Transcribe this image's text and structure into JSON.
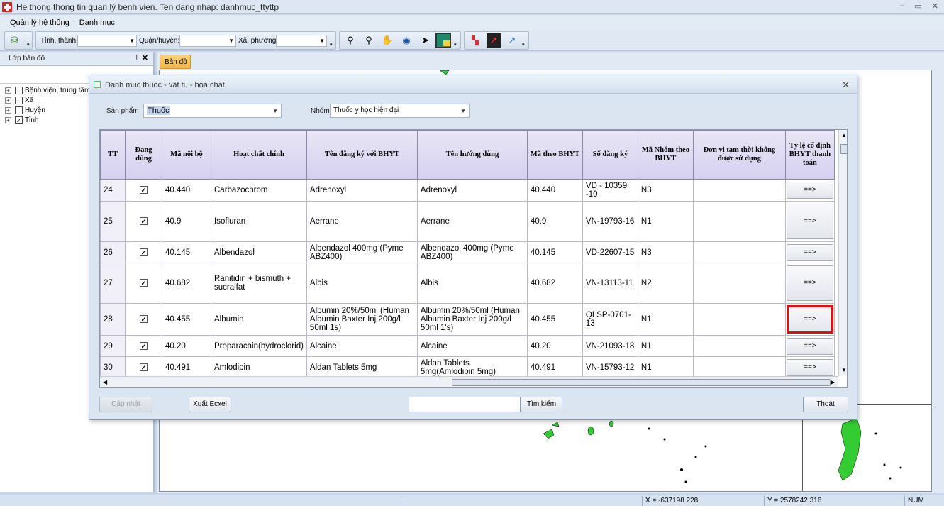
{
  "window": {
    "title": "He thong thong tin quan lý benh vien. Ten dang nhap: danhmuc_ttyttp",
    "controls": [
      "–",
      "▭",
      "✕"
    ]
  },
  "menu": [
    "Quản lý hệ thống",
    "Danh mục"
  ],
  "toolbar": {
    "province_label": "Tỉnh, thành:",
    "district_label": "Quận/huyện:",
    "ward_label": "Xã, phường:"
  },
  "left_panel": {
    "title": "Lớp bản đồ",
    "pin": "⊣",
    "close": "✕",
    "layers": [
      {
        "label": "Bệnh viện, trung tâm",
        "checked": false
      },
      {
        "label": "Xã",
        "checked": false
      },
      {
        "label": "Huyện",
        "checked": false
      },
      {
        "label": "Tỉnh",
        "checked": true
      }
    ]
  },
  "map": {
    "tab_label": "Bản đồ"
  },
  "status": {
    "x": "X = -637198.228",
    "y": "Y = 2578242.316",
    "num": "NUM"
  },
  "dialog": {
    "title": "Danh muc thuoc - vât tu - hóa chat",
    "close": "✕",
    "product_label": "Sản phẩm",
    "product_value": "Thuốc",
    "group_label": "Nhóm",
    "group_value": "Thuốc y học hiện đại",
    "buttons": {
      "update": "Cập nhật",
      "export": "Xuất Ecxel",
      "search": "Tìm kiếm",
      "exit": "Thoát"
    },
    "search_value": "",
    "table": {
      "headers": [
        "TT",
        "Đang dùng",
        "Mã nội bộ",
        "Hoạt chất chính",
        "Tên đăng ký với BHYT",
        "Tên hướng dùng",
        "Mã theo BHYT",
        "Số đăng ký",
        "Mã Nhóm theo BHYT",
        "Đơn vị tạm thời không được sử dụng",
        "Tỷ lệ cố định BHYT thanh toán"
      ],
      "rows": [
        {
          "tt": "24",
          "checked": true,
          "ma": "40.440",
          "hoat_chat": "Carbazochrom",
          "ten_dk": "Adrenoxyl",
          "ten_hd": "Adrenoxyl",
          "ma_bhyt": "40.440",
          "so_dk": "VD - 10359 -10",
          "nhom": "N3",
          "don_vi": "",
          "btn": "==>"
        },
        {
          "tt": "25",
          "checked": true,
          "ma": "40.9",
          "hoat_chat": "Isofluran",
          "ten_dk": "Aerrane",
          "ten_hd": "Aerrane",
          "ma_bhyt": "40.9",
          "so_dk": "VN-19793-16",
          "nhom": "N1",
          "don_vi": "",
          "btn": "==>"
        },
        {
          "tt": "26",
          "checked": true,
          "ma": "40.145",
          "hoat_chat": "Albendazol",
          "ten_dk": "Albendazol 400mg (Pyme ABZ400)",
          "ten_hd": "Albendazol 400mg (Pyme ABZ400)",
          "ma_bhyt": "40.145",
          "so_dk": "VD-22607-15",
          "nhom": "N3",
          "don_vi": "",
          "btn": "==>"
        },
        {
          "tt": "27",
          "checked": true,
          "ma": "40.682",
          "hoat_chat": "Ranitidin + bismuth + sucralfat",
          "ten_dk": "Albis",
          "ten_hd": "Albis",
          "ma_bhyt": "40.682",
          "so_dk": "VN-13113-11",
          "nhom": "N2",
          "don_vi": "",
          "btn": "==>"
        },
        {
          "tt": "28",
          "checked": true,
          "ma": "40.455",
          "hoat_chat": "Albumin",
          "ten_dk": "Albumin 20%/50ml (Human Albumin Baxter Inj 200g/l 50ml 1s)",
          "ten_hd": "Albumin 20%/50ml (Human Albumin Baxter Inj 200g/l 50ml 1's)",
          "ma_bhyt": "40.455",
          "so_dk": "QLSP-0701-13",
          "nhom": "N1",
          "don_vi": "",
          "btn": "==>"
        },
        {
          "tt": "29",
          "checked": true,
          "ma": "40.20",
          "hoat_chat": "Proparacain(hydroclorid)",
          "ten_dk": "Alcaine",
          "ten_hd": "Alcaine",
          "ma_bhyt": "40.20",
          "so_dk": "VN-21093-18",
          "nhom": "N1",
          "don_vi": "",
          "btn": "==>"
        },
        {
          "tt": "30",
          "checked": true,
          "ma": "40.491",
          "hoat_chat": "Amlodipin",
          "ten_dk": "Aldan Tablets 5mg",
          "ten_hd": "Aldan Tablets 5mg(Amlodipin 5mg)",
          "ma_bhyt": "40.491",
          "so_dk": "VN-15793-12",
          "nhom": "N1",
          "don_vi": "",
          "btn": "==>"
        }
      ]
    }
  },
  "colors": {
    "highlight_border": "#e01010",
    "header_bg": "#d5d0ef",
    "map_tab": "#f3b54a",
    "map_land": "#33cc33"
  }
}
